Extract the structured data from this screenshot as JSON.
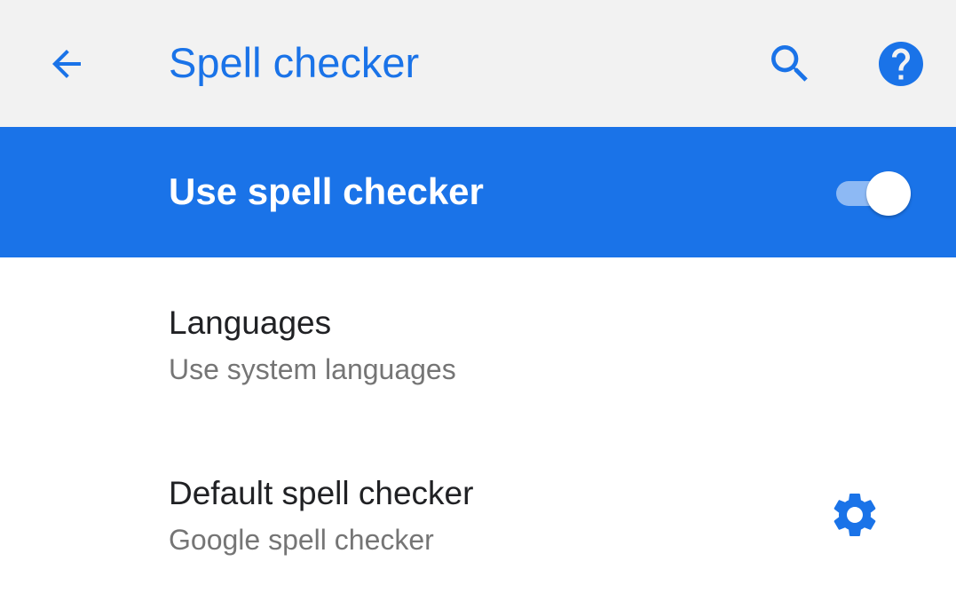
{
  "colors": {
    "accent": "#1a73e8",
    "app_bar_bg": "#f2f2f2",
    "text_primary": "#202124",
    "text_secondary": "#757575"
  },
  "app_bar": {
    "back_icon": "arrow-back-icon",
    "title": "Spell checker",
    "search_icon": "search-icon",
    "help_icon": "help-icon"
  },
  "master_switch": {
    "label": "Use spell checker",
    "checked": true
  },
  "preferences": {
    "languages": {
      "title": "Languages",
      "summary": "Use system languages"
    },
    "default_spell_checker": {
      "title": "Default spell checker",
      "summary": "Google spell checker",
      "settings_icon": "gear-icon"
    }
  }
}
